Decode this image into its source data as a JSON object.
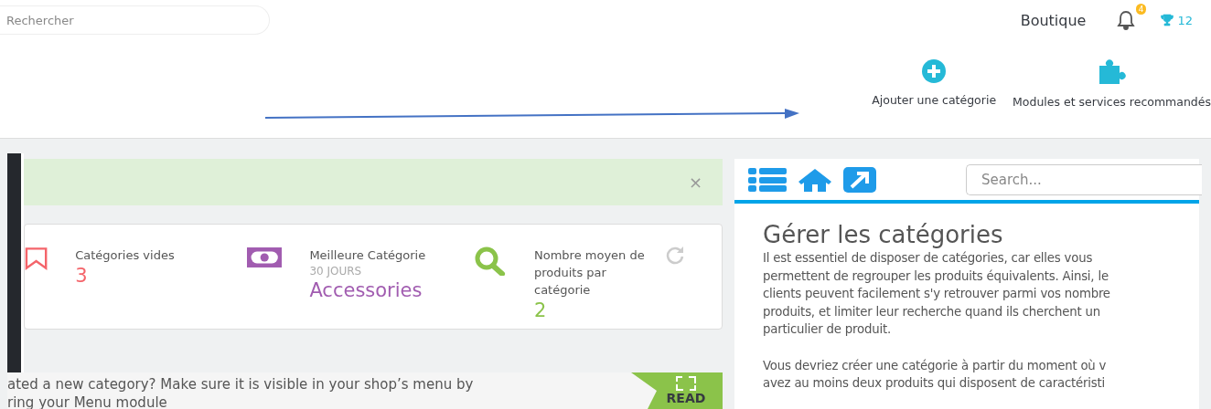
{
  "header": {
    "search": {
      "placeholder": "Rechercher"
    },
    "shop_label": "Boutique",
    "notifications": {
      "count": "4"
    },
    "trophies": {
      "count": "12"
    }
  },
  "toolbar": {
    "buttons": [
      {
        "kind": "add",
        "label": "Ajouter une catégorie"
      },
      {
        "kind": "modules",
        "label": "Modules et services recommandés"
      }
    ]
  },
  "alert": {
    "close": "×"
  },
  "kpis": [
    {
      "kind": "bookmark",
      "color": "#f4646a",
      "title": "Catégories vides",
      "value": "3"
    },
    {
      "kind": "money",
      "color": "#a15cb0",
      "title": "Meilleure Catégorie",
      "subtitle": "30 JOURS",
      "value": "Accessories"
    },
    {
      "kind": "search",
      "color": "#8bc34a",
      "title": "Nombre moyen de produits par catégorie",
      "value": "2"
    }
  ],
  "banner": {
    "lines": [
      "ated a new category? Make sure it is visible in your shop’s menu by",
      "ring your Menu module"
    ],
    "button": "READ"
  },
  "help": {
    "search": {
      "placeholder": "Search..."
    },
    "title": "Gérer les catégories",
    "paragraphs": [
      [
        "Il est essentiel de disposer de catégories, car elles vous",
        "permettent de regrouper les produits équivalents. Ainsi, le",
        "clients peuvent facilement s'y retrouver parmi vos nombre",
        "produits, et limiter leur recherche quand ils cherchent un",
        "particulier de produit."
      ],
      [
        "Vous devriez créer une catégorie à partir du moment où v",
        "avez au moins deux produits qui disposent de caractéristi"
      ]
    ]
  }
}
